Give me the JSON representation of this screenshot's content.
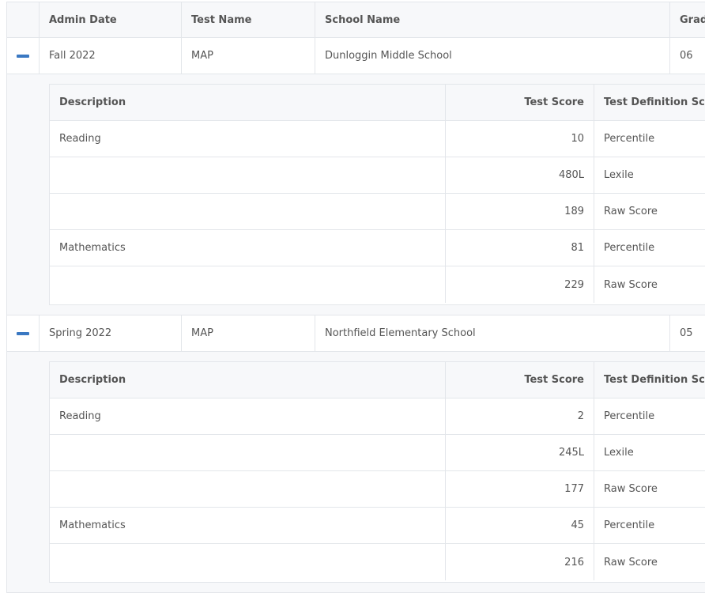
{
  "columns": {
    "admin_date": "Admin Date",
    "test_name": "Test Name",
    "school_name": "School Name",
    "grade": "Grade"
  },
  "sub_columns": {
    "description": "Description",
    "test_score": "Test Score",
    "test_definition_score": "Test Definition Score"
  },
  "records": [
    {
      "admin_date": "Fall 2022",
      "test_name": "MAP",
      "school_name": "Dunloggin Middle School",
      "grade": "06",
      "scores": [
        {
          "description": "Reading",
          "score": "10",
          "definition": "Percentile"
        },
        {
          "description": "",
          "score": "480L",
          "definition": "Lexile"
        },
        {
          "description": "",
          "score": "189",
          "definition": "Raw Score"
        },
        {
          "description": "Mathematics",
          "score": "81",
          "definition": "Percentile"
        },
        {
          "description": "",
          "score": "229",
          "definition": "Raw Score"
        }
      ]
    },
    {
      "admin_date": "Spring 2022",
      "test_name": "MAP",
      "school_name": "Northfield Elementary School",
      "grade": "05",
      "scores": [
        {
          "description": "Reading",
          "score": "2",
          "definition": "Percentile"
        },
        {
          "description": "",
          "score": "245L",
          "definition": "Lexile"
        },
        {
          "description": "",
          "score": "177",
          "definition": "Raw Score"
        },
        {
          "description": "Mathematics",
          "score": "45",
          "definition": "Percentile"
        },
        {
          "description": "",
          "score": "216",
          "definition": "Raw Score"
        }
      ]
    }
  ],
  "colors": {
    "accent": "#3a78c2",
    "border": "#e3e6ea",
    "header_bg": "#f7f8fa"
  }
}
